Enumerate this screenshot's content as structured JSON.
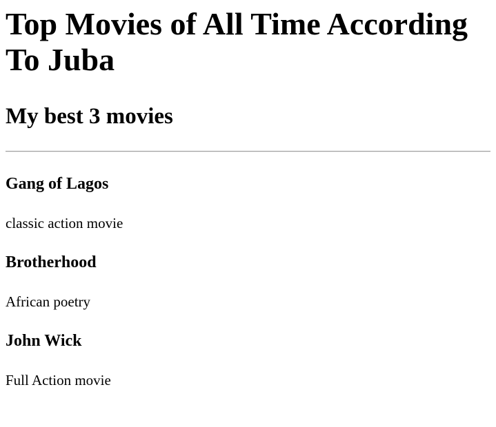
{
  "page": {
    "title": "Top Movies of All Time According To Juba",
    "subtitle": "My best 3 movies"
  },
  "movies": [
    {
      "title": "Gang of Lagos",
      "description": "classic action movie"
    },
    {
      "title": "Brotherhood",
      "description": "African poetry"
    },
    {
      "title": "John Wick",
      "description": "Full Action movie"
    }
  ]
}
